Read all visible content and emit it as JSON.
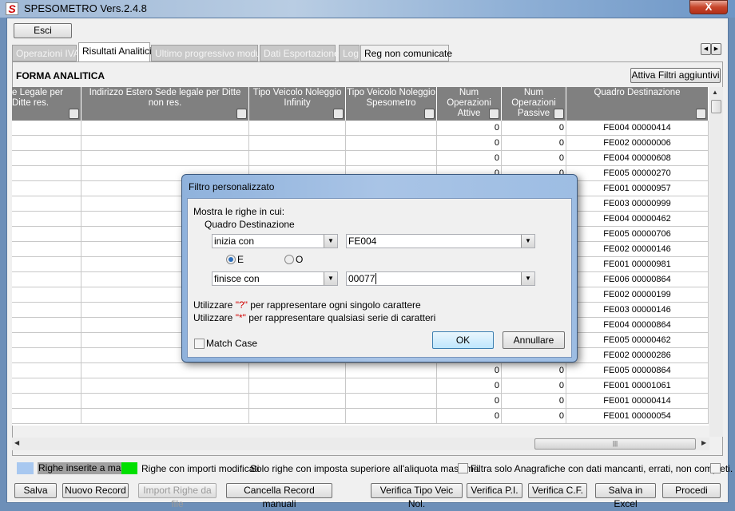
{
  "window": {
    "title": "SPESOMETRO Vers.2.4.8",
    "close_label": "X"
  },
  "toolbar": {
    "exit_label": "Esci"
  },
  "tabs": [
    {
      "label": "Operazioni IVA",
      "state": "disabled"
    },
    {
      "label": "Risultati Analitici",
      "state": "active"
    },
    {
      "label": "Ultimo progressivo modulo",
      "state": "disabled"
    },
    {
      "label": "Dati Esportazione",
      "state": "disabled"
    },
    {
      "label": "Log",
      "state": "disabled"
    },
    {
      "label": "Reg non comunicate",
      "state": "enabled"
    }
  ],
  "panel": {
    "heading": "FORMA ANALITICA",
    "filters_button": "Attiva Filtri aggiuntivi"
  },
  "table": {
    "columns": [
      "e Legale per Ditte res.",
      "Indirizzo Estero Sede legale per Ditte non res.",
      "Tipo Veicolo Noleggio Infinity",
      "Tipo Veicolo Noleggio Spesometro",
      "Num Operazioni Attive",
      "Num Operazioni Passive",
      "Quadro Destinazione"
    ],
    "rows": [
      {
        "attive": "0",
        "passive": "0",
        "quadro": "FE004 00000414"
      },
      {
        "attive": "0",
        "passive": "0",
        "quadro": "FE002 00000006"
      },
      {
        "attive": "0",
        "passive": "0",
        "quadro": "FE004 00000608"
      },
      {
        "attive": "0",
        "passive": "0",
        "quadro": "FE005 00000270"
      },
      {
        "attive": "",
        "passive": "",
        "quadro": "FE001 00000957"
      },
      {
        "attive": "",
        "passive": "",
        "quadro": "FE003 00000999"
      },
      {
        "attive": "",
        "passive": "",
        "quadro": "FE004 00000462"
      },
      {
        "attive": "",
        "passive": "",
        "quadro": "FE005 00000706"
      },
      {
        "attive": "",
        "passive": "",
        "quadro": "FE002 00000146"
      },
      {
        "attive": "",
        "passive": "",
        "quadro": "FE001 00000981"
      },
      {
        "attive": "",
        "passive": "",
        "quadro": "FE006 00000864"
      },
      {
        "attive": "",
        "passive": "",
        "quadro": "FE002 00000199"
      },
      {
        "attive": "",
        "passive": "",
        "quadro": "FE003 00000146"
      },
      {
        "attive": "",
        "passive": "",
        "quadro": "FE004 00000864"
      },
      {
        "attive": "",
        "passive": "",
        "quadro": "FE005 00000462"
      },
      {
        "attive": "",
        "passive": "",
        "quadro": "FE002 00000286"
      },
      {
        "attive": "0",
        "passive": "0",
        "quadro": "FE005 00000864"
      },
      {
        "attive": "0",
        "passive": "0",
        "quadro": "FE001 00001061"
      },
      {
        "attive": "0",
        "passive": "0",
        "quadro": "FE001 00000414"
      },
      {
        "attive": "0",
        "passive": "0",
        "quadro": "FE001 00000054"
      }
    ]
  },
  "legend": {
    "manual_label": "Righe inserite a mano",
    "manual_color": "#a8c8f0",
    "modified_label": "Righe con importi modificati",
    "modified_color": "#00e000",
    "tax_filter_label": "Solo righe con imposta superiore all'aliquota massima",
    "missing_filter_label": "Filtra solo Anagrafiche con dati mancanti, errati, non completi."
  },
  "footer": {
    "save": "Salva",
    "new_record": "Nuovo Record",
    "import_rows": "Import Righe da file",
    "delete_manual": "Cancella Record manuali",
    "check_vehicle": "Verifica Tipo Veic Nol.",
    "check_pi": "Verifica P.I.",
    "check_cf": "Verifica C.F.",
    "save_excel": "Salva in Excel",
    "proceed": "Procedi"
  },
  "dialog": {
    "title": "Filtro personalizzato",
    "prompt": "Mostra le righe in cui:",
    "field": "Quadro Destinazione",
    "op1": "inizia con",
    "val1": "FE004",
    "radio_and": "E",
    "radio_or": "O",
    "selected": "E",
    "op2": "finisce con",
    "val2": "00077",
    "hint1_pre": "Utilizzare ",
    "hint1_char": "\"?\"",
    "hint1_post": " per rappresentare ogni singolo carattere",
    "hint2_pre": "Utilizzare ",
    "hint2_char": "\"*\"",
    "hint2_post": " per rappresentare qualsiasi serie di caratteri",
    "match_case": "Match Case",
    "ok": "OK",
    "cancel": "Annullare"
  }
}
